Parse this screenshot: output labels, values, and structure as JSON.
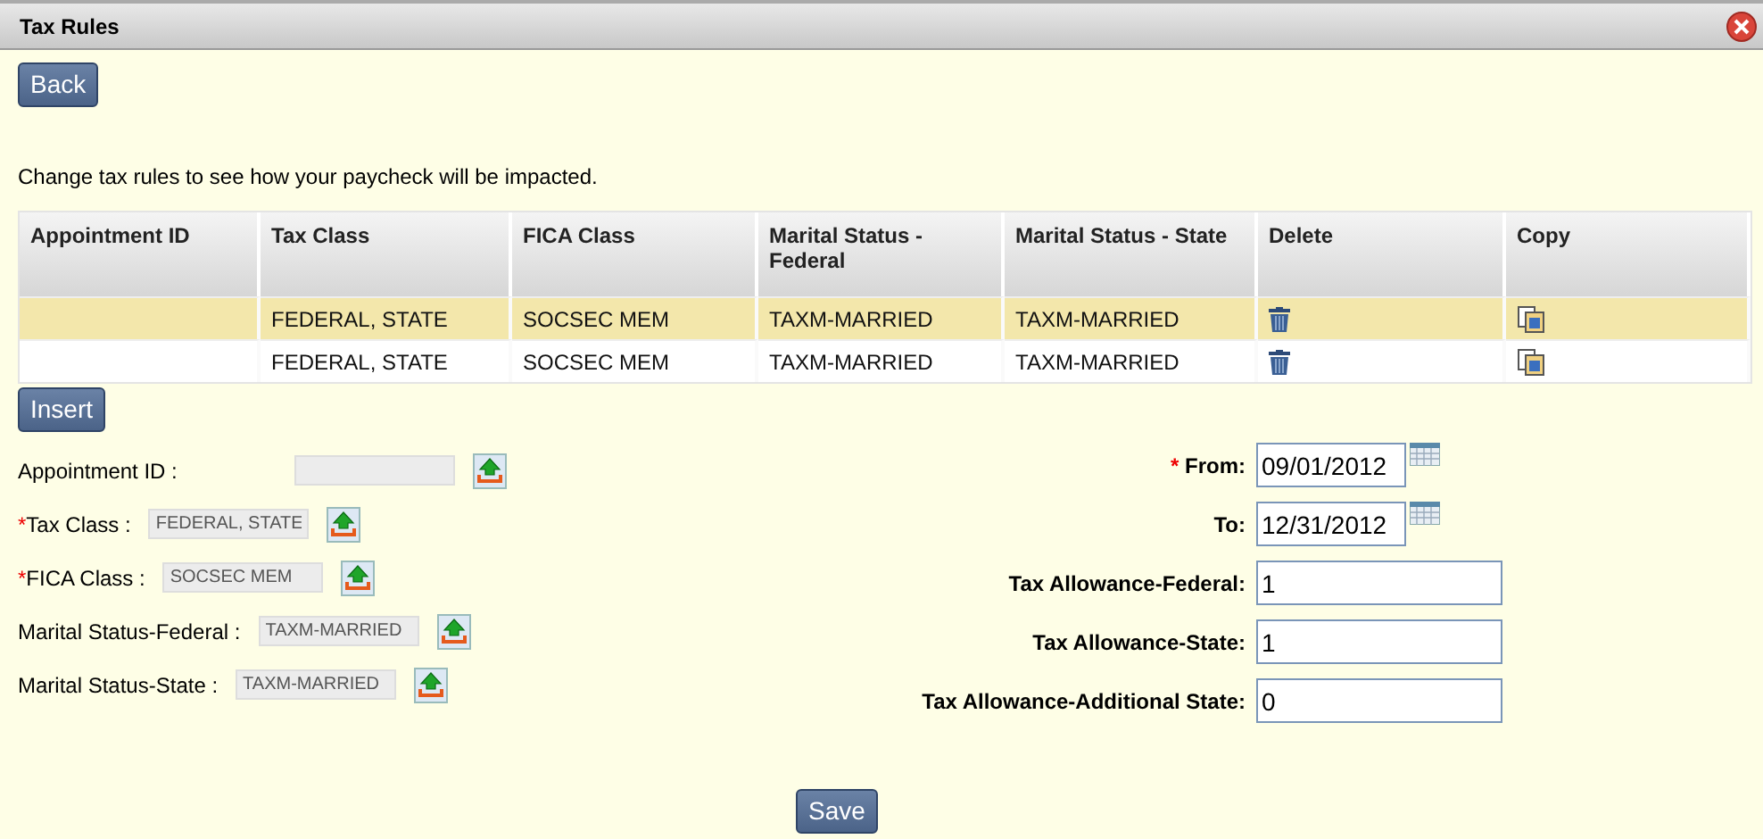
{
  "window": {
    "title": "Tax Rules"
  },
  "back_button": "Back",
  "intro": "Change tax rules to see how your paycheck will be impacted.",
  "table": {
    "columns": [
      "Appointment ID",
      "Tax Class",
      "FICA Class",
      "Marital Status - Federal",
      "Marital Status - State",
      "Delete",
      "Copy"
    ],
    "rows": [
      {
        "selected": true,
        "cells": [
          null,
          "FEDERAL, STATE",
          "SOCSEC MEM",
          "TAXM-MARRIED",
          "TAXM-MARRIED"
        ]
      },
      {
        "selected": false,
        "cells": [
          null,
          "FEDERAL, STATE",
          "SOCSEC MEM",
          "TAXM-MARRIED",
          "TAXM-MARRIED"
        ]
      }
    ]
  },
  "insert_button": "Insert",
  "left_fields": [
    {
      "label": "Appointment ID :"
    },
    {
      "marker": "*",
      "label": "Tax Class :",
      "value": "FEDERAL, STATE"
    },
    {
      "marker": "*",
      "label": "FICA Class :",
      "value": "SOCSEC MEM"
    },
    {
      "label": "Marital Status-Federal :",
      "value": "TAXM-MARRIED"
    },
    {
      "label": "Marital Status-State :",
      "value": "TAXM-MARRIED"
    }
  ],
  "right_fields": [
    {
      "kind": "date",
      "marker": "*",
      "label": "From:",
      "value": "09/01/2012"
    },
    {
      "kind": "date",
      "label": "To:",
      "value": "12/31/2012"
    },
    {
      "kind": "text",
      "label": "Tax Allowance-Federal:",
      "value": "1"
    },
    {
      "kind": "text",
      "label": "Tax Allowance-State:",
      "value": "1"
    },
    {
      "kind": "text",
      "label": "Tax Allowance-Additional State:",
      "value": "0"
    }
  ],
  "save_button": "Save"
}
